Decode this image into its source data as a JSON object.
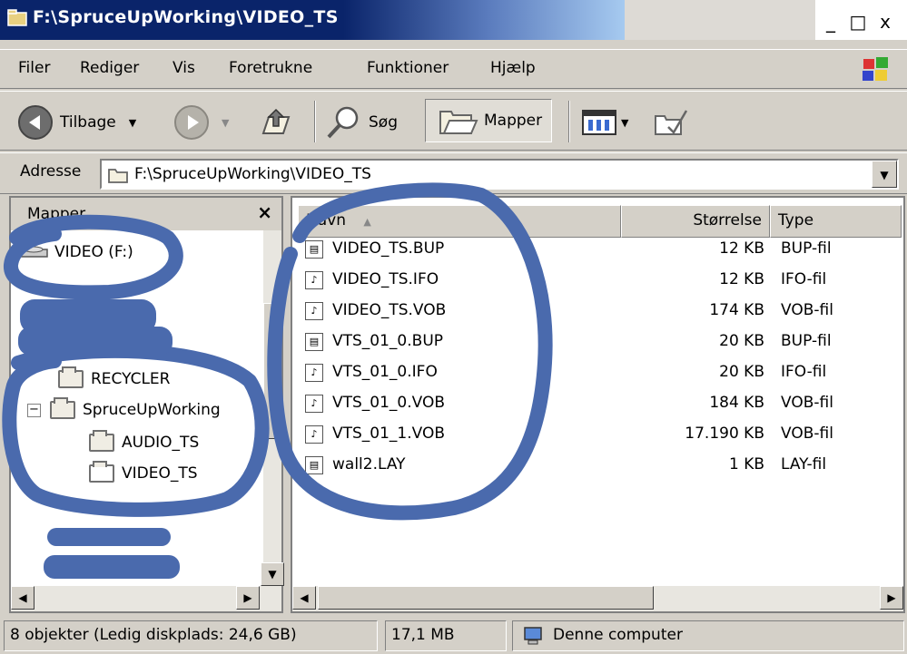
{
  "window": {
    "title": "F:\\SpruceUpWorking\\VIDEO_TS",
    "controls": [
      "_",
      "□",
      "x"
    ]
  },
  "menu": {
    "items": [
      "Filer",
      "Rediger",
      "Vis",
      "Foretrukne",
      "Funktioner",
      "Hjælp"
    ]
  },
  "toolbar": {
    "back_label": "Tilbage",
    "search_label": "Søg",
    "folders_label": "Mapper"
  },
  "address": {
    "label": "Adresse",
    "value": "F:\\SpruceUpWorking\\VIDEO_TS"
  },
  "folders_pane": {
    "header": "Mapper",
    "close": "×",
    "items": [
      {
        "label": "VIDEO (F:)"
      },
      {
        "label": "RECYCLER"
      },
      {
        "label": "SpruceUpWorking",
        "expander": "−"
      },
      {
        "label": "AUDIO_TS"
      },
      {
        "label": "VIDEO_TS"
      }
    ]
  },
  "file_list": {
    "columns": {
      "name": "Navn",
      "size": "Størrelse",
      "type": "Type"
    },
    "rows": [
      {
        "name": "VIDEO_TS.BUP",
        "size": "12 KB",
        "type": "BUP-fil",
        "icon": "document-icon"
      },
      {
        "name": "VIDEO_TS.IFO",
        "size": "12 KB",
        "type": "IFO-fil",
        "icon": "media-file-icon"
      },
      {
        "name": "VIDEO_TS.VOB",
        "size": "174 KB",
        "type": "VOB-fil",
        "icon": "media-file-icon"
      },
      {
        "name": "VTS_01_0.BUP",
        "size": "20 KB",
        "type": "BUP-fil",
        "icon": "document-icon"
      },
      {
        "name": "VTS_01_0.IFO",
        "size": "20 KB",
        "type": "IFO-fil",
        "icon": "media-file-icon"
      },
      {
        "name": "VTS_01_0.VOB",
        "size": "184 KB",
        "type": "VOB-fil",
        "icon": "media-file-icon"
      },
      {
        "name": "VTS_01_1.VOB",
        "size": "17.190 KB",
        "type": "VOB-fil",
        "icon": "media-file-icon"
      },
      {
        "name": "wall2.LAY",
        "size": "1 KB",
        "type": "LAY-fil",
        "icon": "document-icon"
      }
    ]
  },
  "status": {
    "objects": "8 objekter (Ledig diskplads: 24,6 GB)",
    "size": "17,1 MB",
    "zone": "Denne computer"
  },
  "colors": {
    "title_bar": "#0a246a",
    "scribble": "#4a6aad",
    "chrome": "#d4d0c8"
  }
}
